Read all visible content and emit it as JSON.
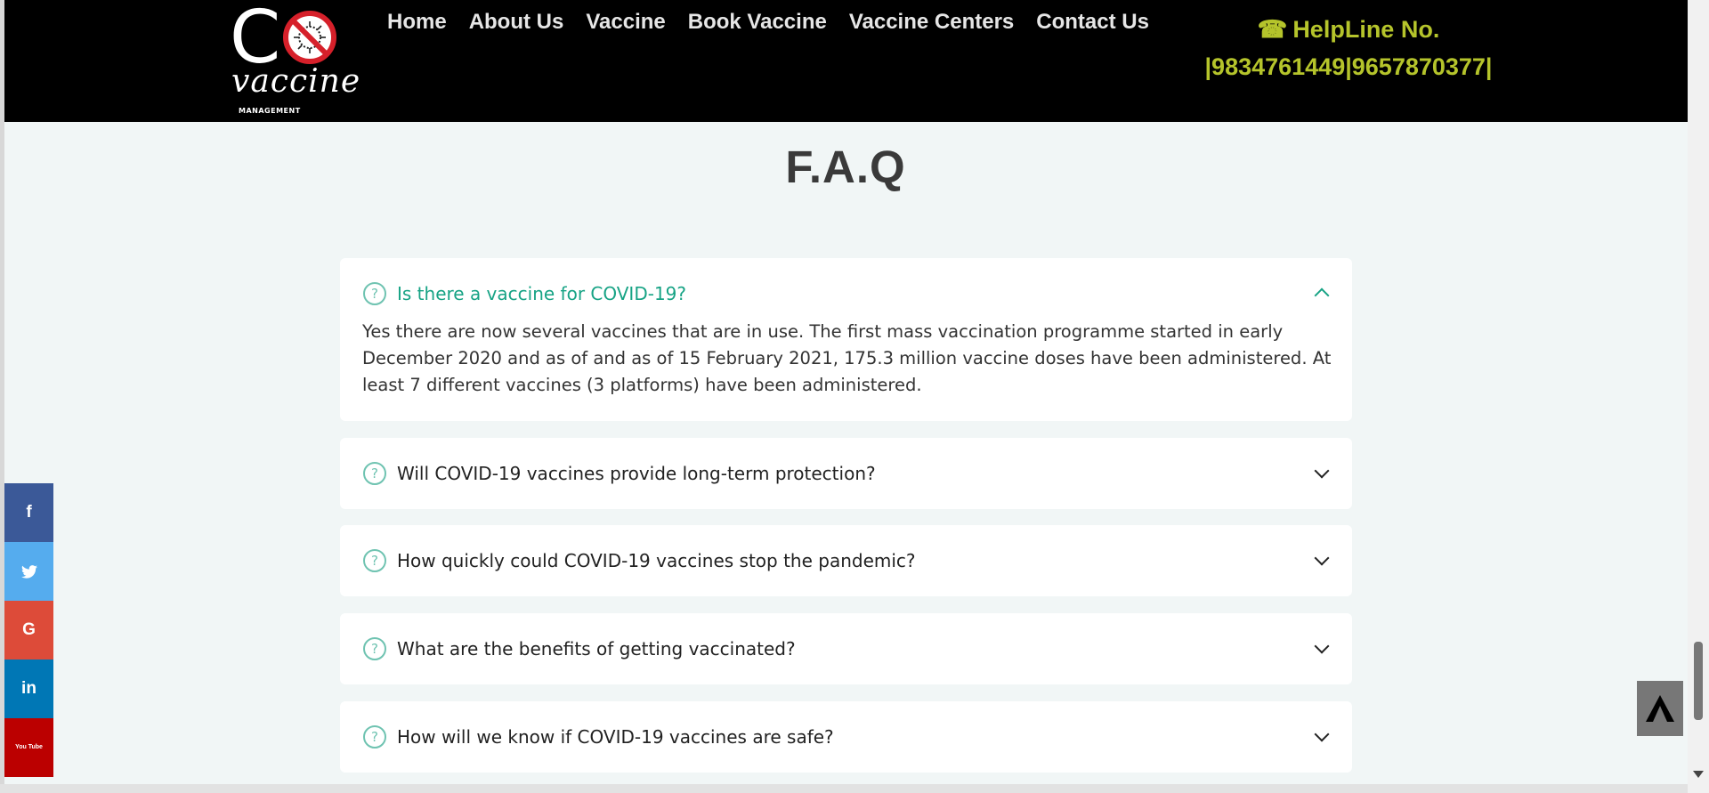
{
  "brand": {
    "logo_letter": "C",
    "logo_word": "vaccine",
    "logo_sub": "MANAGEMENT"
  },
  "nav": {
    "items": [
      "Home",
      "About Us",
      "Vaccine",
      "Book Vaccine",
      "Vaccine Centers",
      "Contact Us"
    ]
  },
  "helpline": {
    "label": "HelpLine No.",
    "numbers": "|9834761449|9657870377|"
  },
  "faq": {
    "title": "F.A.Q",
    "items": [
      {
        "question": "Is there a vaccine for COVID-19?",
        "answer": "Yes there are now several vaccines that are in use. The first mass vaccination programme started in early December 2020 and as of and as of 15 February 2021, 175.3 million vaccine doses have been administered. At least 7 different vaccines (3 platforms) have been administered.",
        "expanded": true
      },
      {
        "question": "Will COVID-19 vaccines provide long-term protection?",
        "expanded": false
      },
      {
        "question": "How quickly could COVID-19 vaccines stop the pandemic?",
        "expanded": false
      },
      {
        "question": "What are the benefits of getting vaccinated?",
        "expanded": false
      },
      {
        "question": "How will we know if COVID-19 vaccines are safe?",
        "expanded": false
      }
    ]
  },
  "social": {
    "items": [
      {
        "name": "facebook",
        "glyph": "f",
        "color": "#3b5998"
      },
      {
        "name": "twitter",
        "glyph": "🐦",
        "color": "#55acee"
      },
      {
        "name": "google",
        "glyph": "G",
        "color": "#dd4b39"
      },
      {
        "name": "linkedin",
        "glyph": "in",
        "color": "#0077b5"
      },
      {
        "name": "youtube",
        "glyph": "You Tube",
        "color": "#bb0000"
      }
    ]
  },
  "colors": {
    "accent": "#17a385",
    "helpline": "#b5c42b",
    "header_bg": "#000000",
    "page_bg": "#f1f6f6"
  }
}
